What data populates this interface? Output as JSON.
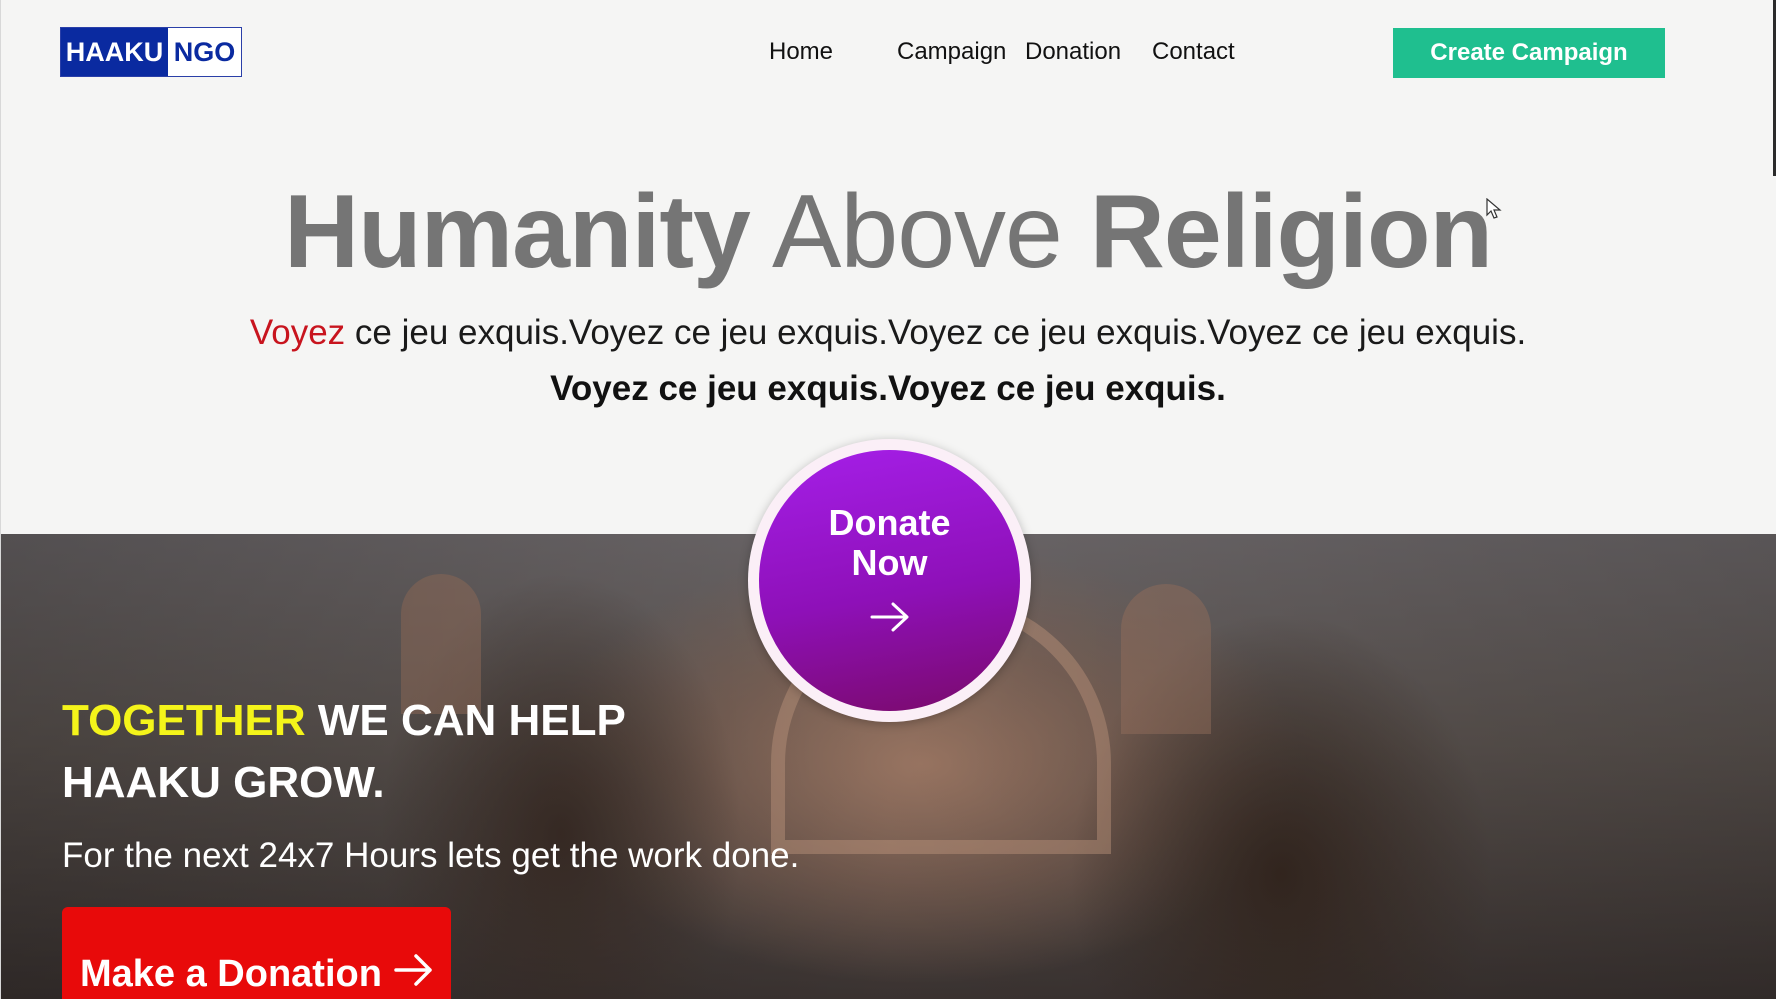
{
  "header": {
    "logo": {
      "part1": "HAAKU",
      "part2": "NGO"
    },
    "nav": [
      "Home",
      "Campaign",
      "Donation",
      "Contact"
    ],
    "cta_label": "Create Campaign"
  },
  "hero": {
    "title_word1": "Humanity",
    "title_word2": "Above",
    "title_word3": "Religion",
    "sub_highlight": "Voyez",
    "sub_rest": " ce jeu exquis.Voyez ce jeu exquis.Voyez ce jeu exquis.Voyez ce jeu exquis.",
    "sub_bold": "Voyez ce jeu exquis.Voyez ce jeu exquis."
  },
  "donate_circle": {
    "line1": "Donate",
    "line2": "Now",
    "icon": "arrow-right-icon"
  },
  "banner": {
    "title_highlight": "TOGETHER",
    "title_rest_line1": " WE CAN HELP",
    "title_line2": "HAAKU GROW.",
    "subtitle": "For the next 24x7 Hours lets get the work done.",
    "button_label": "Make a Donation",
    "button_icon": "arrow-right-icon"
  },
  "colors": {
    "brand_blue": "#0a2aa0",
    "cta_green": "#1fbf8f",
    "accent_red": "#c8141e",
    "highlight_yellow": "#f4f41a",
    "donate_purple": "#a51fe8",
    "button_red": "#e80a0a"
  }
}
